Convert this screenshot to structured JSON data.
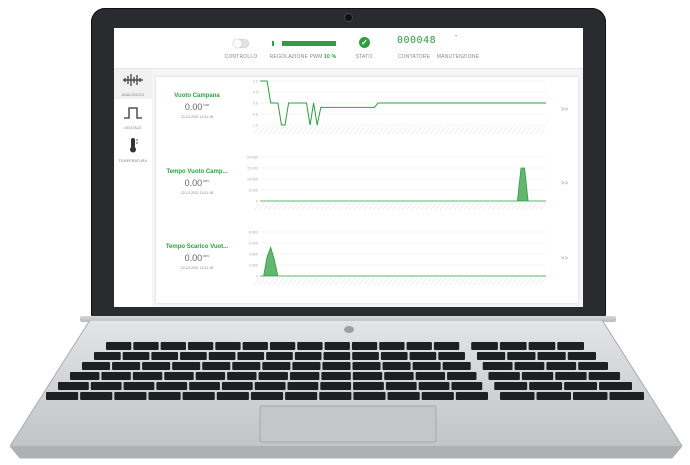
{
  "topbar": {
    "controllo_label": "CONTROLLO",
    "pwm_label": "REGOLAZIONE PWM",
    "pwm_value": "10 %",
    "pwm_fraction": 0.1,
    "stato_label": "STATO",
    "contatore_value": "000048",
    "contatore_label": "CONTATORE",
    "manutenzione_value": "-",
    "manutenzione_label": "MANUTENZIONE"
  },
  "sidebar": {
    "items": [
      {
        "label": "ANALOGICO",
        "icon": "waveform-icon",
        "active": true
      },
      {
        "label": "DIGITALE",
        "icon": "square-wave-icon",
        "active": false
      },
      {
        "label": "TEMPERATURA",
        "icon": "thermometer-icon",
        "active": false
      }
    ]
  },
  "rows": [
    {
      "title": "Vuoto Campana",
      "value": "0.00",
      "unit": "bar",
      "timestamp": "22-10-2021 14:11:18"
    },
    {
      "title": "Tempo Vuoto Camp...",
      "value": "0.00",
      "unit": "sec",
      "timestamp": "22-10-2021 14:11:18"
    },
    {
      "title": "Tempo Scarico Vuot...",
      "value": "0.00",
      "unit": "sec",
      "timestamp": "22-10-2021 14:11:18"
    }
  ],
  "more_label": ">>",
  "colors": {
    "accent": "#2e9e3f",
    "lid": "#2a2b2e",
    "body": "#c9cbcd"
  },
  "chart_data": [
    {
      "type": "line",
      "yticks": [
        "1.0",
        "0.5",
        "0.0",
        "-0.5",
        "-1.0"
      ],
      "ylim": [
        -1.0,
        1.0
      ],
      "values": [
        1,
        1,
        1,
        0,
        0,
        0,
        -1,
        -1,
        0,
        0,
        0,
        0,
        0,
        0,
        -1,
        0,
        -1,
        -0.2,
        -0.2,
        -0.2,
        -0.2,
        -0.2,
        -0.2,
        -0.2,
        -0.2,
        -0.2,
        -0.2,
        -0.2,
        -0.2,
        -0.2,
        -0.2,
        -0.2,
        -0.2,
        0,
        0,
        0,
        0,
        0,
        0,
        0,
        0,
        0,
        0,
        0,
        0,
        0,
        0,
        0,
        0,
        0,
        0,
        0,
        0,
        0,
        0,
        0,
        0,
        0,
        0,
        0,
        0,
        0,
        0,
        0,
        0,
        0,
        0,
        0,
        0,
        0,
        0,
        0,
        0,
        0,
        0,
        0,
        0,
        0,
        0,
        0,
        0
      ]
    },
    {
      "type": "area",
      "yticks": [
        "20,000",
        "15,000",
        "10,000",
        "5,000",
        "0"
      ],
      "ylim": [
        0,
        20000
      ],
      "values": [
        0,
        0,
        0,
        0,
        0,
        0,
        0,
        0,
        0,
        0,
        0,
        0,
        0,
        0,
        0,
        0,
        0,
        0,
        0,
        0,
        0,
        0,
        0,
        0,
        0,
        0,
        0,
        0,
        0,
        0,
        0,
        0,
        0,
        0,
        0,
        0,
        0,
        0,
        0,
        0,
        0,
        0,
        0,
        0,
        0,
        0,
        0,
        0,
        0,
        0,
        0,
        0,
        0,
        0,
        0,
        0,
        0,
        0,
        0,
        0,
        0,
        0,
        0,
        0,
        0,
        0,
        0,
        0,
        0,
        0,
        0,
        0,
        0,
        15000,
        15000,
        0,
        0,
        0,
        0,
        0,
        0
      ]
    },
    {
      "type": "area",
      "yticks": [
        "8,000",
        "6,000",
        "4,000",
        "2,000",
        "0"
      ],
      "ylim": [
        0,
        8000
      ],
      "values": [
        0,
        0,
        3500,
        5200,
        3000,
        0,
        0,
        0,
        0,
        0,
        0,
        0,
        0,
        0,
        0,
        0,
        0,
        0,
        0,
        0,
        0,
        0,
        0,
        0,
        0,
        0,
        0,
        0,
        0,
        0,
        0,
        0,
        0,
        0,
        0,
        0,
        0,
        0,
        0,
        0,
        0,
        0,
        0,
        0,
        0,
        0,
        0,
        0,
        0,
        0,
        0,
        0,
        0,
        0,
        0,
        0,
        0,
        0,
        0,
        0,
        0,
        0,
        0,
        0,
        0,
        0,
        0,
        0,
        0,
        0,
        0,
        0,
        0,
        0,
        0,
        0,
        0,
        0,
        0,
        0,
        0
      ]
    }
  ]
}
